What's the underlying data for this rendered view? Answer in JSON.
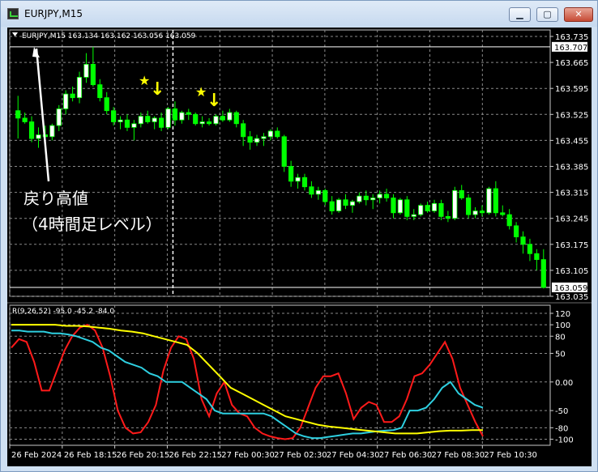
{
  "window": {
    "title": "EURJPY,M15",
    "buttons": {
      "minimize": "▁",
      "maximize": "▢",
      "close": "✕"
    }
  },
  "chart_data": [
    {
      "type": "candlestick",
      "header": "EURJPY,M15 163.134 163.162 163.056 163.059",
      "symbol": "EURJPY",
      "timeframe": "M15",
      "ohlc_header": {
        "open": 163.134,
        "high": 163.162,
        "low": 163.056,
        "close": 163.059
      },
      "y_ticks": [
        "163.735",
        "163.665",
        "163.595",
        "163.525",
        "163.455",
        "163.385",
        "163.315",
        "163.245",
        "163.175",
        "163.105",
        "163.035"
      ],
      "ylim": [
        163.035,
        163.735
      ],
      "price_labels": [
        "163.707",
        "163.059"
      ],
      "horizontal_levels": [
        163.707,
        163.059
      ],
      "x_ticks": [
        "26 Feb 2024",
        "26 Feb 18:15",
        "26 Feb 20:15",
        "26 Feb 22:15",
        "27 Feb 00:30",
        "27 Feb 02:30",
        "27 Feb 04:30",
        "27 Feb 06:30",
        "27 Feb 08:30",
        "27 Feb 10:30"
      ],
      "vertical_levels": [
        "26 Feb 22:15"
      ],
      "bull_color": "#ffffff",
      "bear_color": "#00ff00",
      "grid": true,
      "annotations": {
        "label_line1": "戻り高値",
        "label_line2": "（4時間足レベル）",
        "star": "★",
        "arrow": "↓",
        "marker_color": "#ffff00",
        "text_color": "#ffffff"
      },
      "candles": [
        {
          "o": 163.535,
          "h": 163.575,
          "l": 163.46,
          "c": 163.515
        },
        {
          "o": 163.515,
          "h": 163.53,
          "l": 163.5,
          "c": 163.505
        },
        {
          "o": 163.505,
          "h": 163.52,
          "l": 163.45,
          "c": 163.46
        },
        {
          "o": 163.46,
          "h": 163.49,
          "l": 163.435,
          "c": 163.47
        },
        {
          "o": 163.47,
          "h": 163.495,
          "l": 163.455,
          "c": 163.465
        },
        {
          "o": 163.465,
          "h": 163.5,
          "l": 163.455,
          "c": 163.495
        },
        {
          "o": 163.495,
          "h": 163.55,
          "l": 163.48,
          "c": 163.54
        },
        {
          "o": 163.54,
          "h": 163.59,
          "l": 163.525,
          "c": 163.58
        },
        {
          "o": 163.58,
          "h": 163.6,
          "l": 163.56,
          "c": 163.57
        },
        {
          "o": 163.57,
          "h": 163.64,
          "l": 163.555,
          "c": 163.625
        },
        {
          "o": 163.625,
          "h": 163.69,
          "l": 163.61,
          "c": 163.66
        },
        {
          "o": 163.66,
          "h": 163.707,
          "l": 163.6,
          "c": 163.605
        },
        {
          "o": 163.605,
          "h": 163.62,
          "l": 163.56,
          "c": 163.57
        },
        {
          "o": 163.57,
          "h": 163.585,
          "l": 163.525,
          "c": 163.535
        },
        {
          "o": 163.535,
          "h": 163.545,
          "l": 163.495,
          "c": 163.505
        },
        {
          "o": 163.505,
          "h": 163.52,
          "l": 163.485,
          "c": 163.51
        },
        {
          "o": 163.51,
          "h": 163.525,
          "l": 163.48,
          "c": 163.49
        },
        {
          "o": 163.49,
          "h": 163.51,
          "l": 163.455,
          "c": 163.5
        },
        {
          "o": 163.5,
          "h": 163.53,
          "l": 163.49,
          "c": 163.52
        },
        {
          "o": 163.52,
          "h": 163.535,
          "l": 163.5,
          "c": 163.505
        },
        {
          "o": 163.505,
          "h": 163.52,
          "l": 163.485,
          "c": 163.515
        },
        {
          "o": 163.515,
          "h": 163.53,
          "l": 163.48,
          "c": 163.49
        },
        {
          "o": 163.49,
          "h": 163.545,
          "l": 163.485,
          "c": 163.54
        },
        {
          "o": 163.54,
          "h": 163.56,
          "l": 163.495,
          "c": 163.51
        },
        {
          "o": 163.51,
          "h": 163.535,
          "l": 163.5,
          "c": 163.53
        },
        {
          "o": 163.53,
          "h": 163.54,
          "l": 163.51,
          "c": 163.525
        },
        {
          "o": 163.525,
          "h": 163.53,
          "l": 163.495,
          "c": 163.5
        },
        {
          "o": 163.5,
          "h": 163.52,
          "l": 163.49,
          "c": 163.505
        },
        {
          "o": 163.505,
          "h": 163.515,
          "l": 163.495,
          "c": 163.5
        },
        {
          "o": 163.5,
          "h": 163.525,
          "l": 163.495,
          "c": 163.52
        },
        {
          "o": 163.52,
          "h": 163.535,
          "l": 163.505,
          "c": 163.51
        },
        {
          "o": 163.51,
          "h": 163.54,
          "l": 163.505,
          "c": 163.53
        },
        {
          "o": 163.53,
          "h": 163.535,
          "l": 163.49,
          "c": 163.5
        },
        {
          "o": 163.5,
          "h": 163.51,
          "l": 163.44,
          "c": 163.465
        },
        {
          "o": 163.465,
          "h": 163.48,
          "l": 163.43,
          "c": 163.45
        },
        {
          "o": 163.45,
          "h": 163.47,
          "l": 163.44,
          "c": 163.46
        },
        {
          "o": 163.46,
          "h": 163.475,
          "l": 163.44,
          "c": 163.465
        },
        {
          "o": 163.465,
          "h": 163.485,
          "l": 163.455,
          "c": 163.48
        },
        {
          "o": 163.48,
          "h": 163.49,
          "l": 163.46,
          "c": 163.465
        },
        {
          "o": 163.465,
          "h": 163.47,
          "l": 163.37,
          "c": 163.385
        },
        {
          "o": 163.385,
          "h": 163.4,
          "l": 163.33,
          "c": 163.345
        },
        {
          "o": 163.345,
          "h": 163.365,
          "l": 163.325,
          "c": 163.355
        },
        {
          "o": 163.355,
          "h": 163.365,
          "l": 163.32,
          "c": 163.33
        },
        {
          "o": 163.33,
          "h": 163.345,
          "l": 163.3,
          "c": 163.31
        },
        {
          "o": 163.31,
          "h": 163.33,
          "l": 163.295,
          "c": 163.32
        },
        {
          "o": 163.32,
          "h": 163.325,
          "l": 163.28,
          "c": 163.29
        },
        {
          "o": 163.29,
          "h": 163.305,
          "l": 163.255,
          "c": 163.265
        },
        {
          "o": 163.265,
          "h": 163.3,
          "l": 163.26,
          "c": 163.295
        },
        {
          "o": 163.295,
          "h": 163.31,
          "l": 163.27,
          "c": 163.28
        },
        {
          "o": 163.28,
          "h": 163.295,
          "l": 163.26,
          "c": 163.29
        },
        {
          "o": 163.29,
          "h": 163.315,
          "l": 163.285,
          "c": 163.305
        },
        {
          "o": 163.305,
          "h": 163.32,
          "l": 163.28,
          "c": 163.295
        },
        {
          "o": 163.295,
          "h": 163.31,
          "l": 163.27,
          "c": 163.3
        },
        {
          "o": 163.3,
          "h": 163.32,
          "l": 163.285,
          "c": 163.31
        },
        {
          "o": 163.31,
          "h": 163.325,
          "l": 163.29,
          "c": 163.3
        },
        {
          "o": 163.3,
          "h": 163.31,
          "l": 163.245,
          "c": 163.26
        },
        {
          "o": 163.26,
          "h": 163.3,
          "l": 163.255,
          "c": 163.295
        },
        {
          "o": 163.295,
          "h": 163.305,
          "l": 163.24,
          "c": 163.25
        },
        {
          "o": 163.25,
          "h": 163.27,
          "l": 163.24,
          "c": 163.255
        },
        {
          "o": 163.255,
          "h": 163.285,
          "l": 163.25,
          "c": 163.28
        },
        {
          "o": 163.28,
          "h": 163.29,
          "l": 163.26,
          "c": 163.265
        },
        {
          "o": 163.265,
          "h": 163.295,
          "l": 163.26,
          "c": 163.285
        },
        {
          "o": 163.285,
          "h": 163.295,
          "l": 163.24,
          "c": 163.25
        },
        {
          "o": 163.25,
          "h": 163.265,
          "l": 163.235,
          "c": 163.245
        },
        {
          "o": 163.245,
          "h": 163.33,
          "l": 163.24,
          "c": 163.32
        },
        {
          "o": 163.32,
          "h": 163.335,
          "l": 163.295,
          "c": 163.3
        },
        {
          "o": 163.3,
          "h": 163.31,
          "l": 163.245,
          "c": 163.255
        },
        {
          "o": 163.255,
          "h": 163.275,
          "l": 163.245,
          "c": 163.265
        },
        {
          "o": 163.265,
          "h": 163.28,
          "l": 163.25,
          "c": 163.26
        },
        {
          "o": 163.26,
          "h": 163.33,
          "l": 163.255,
          "c": 163.325
        },
        {
          "o": 163.325,
          "h": 163.345,
          "l": 163.25,
          "c": 163.26
        },
        {
          "o": 163.26,
          "h": 163.28,
          "l": 163.25,
          "c": 163.255
        },
        {
          "o": 163.255,
          "h": 163.27,
          "l": 163.215,
          "c": 163.225
        },
        {
          "o": 163.225,
          "h": 163.235,
          "l": 163.18,
          "c": 163.195
        },
        {
          "o": 163.195,
          "h": 163.21,
          "l": 163.15,
          "c": 163.175
        },
        {
          "o": 163.175,
          "h": 163.19,
          "l": 163.13,
          "c": 163.15
        },
        {
          "o": 163.15,
          "h": 163.162,
          "l": 163.105,
          "c": 163.134
        },
        {
          "o": 163.134,
          "h": 163.162,
          "l": 163.056,
          "c": 163.059
        }
      ]
    },
    {
      "type": "line",
      "header": "R(9,26,52) -95.0 -45.2 -84.0",
      "indicator": "R(9,26,52)",
      "current_values": [
        -95.0,
        -45.2,
        -84.0
      ],
      "y_ticks": [
        "120",
        "100",
        "80",
        "50",
        "0.00",
        "-50",
        "-80",
        "-100"
      ],
      "ylim": [
        -105,
        120
      ],
      "grid": true,
      "series": [
        {
          "color": "#ff1a1a",
          "values": [
            60,
            75,
            70,
            35,
            -15,
            -15,
            20,
            55,
            80,
            95,
            100,
            90,
            60,
            10,
            -50,
            -80,
            -90,
            -88,
            -70,
            -40,
            20,
            60,
            80,
            75,
            40,
            -30,
            -60,
            -20,
            0,
            -40,
            -55,
            -60,
            -80,
            -90,
            -95,
            -98,
            -100,
            -98,
            -80,
            -45,
            -10,
            10,
            10,
            15,
            -20,
            -65,
            -45,
            -35,
            -40,
            -70,
            -70,
            -60,
            -30,
            10,
            15,
            30,
            50,
            70,
            40,
            -10,
            -40,
            -70,
            -95
          ]
        },
        {
          "color": "#2ecfe0",
          "values": [
            90,
            90,
            88,
            88,
            88,
            85,
            85,
            83,
            80,
            75,
            70,
            60,
            55,
            45,
            35,
            30,
            25,
            15,
            10,
            0,
            0,
            0,
            -10,
            -20,
            -30,
            -50,
            -55,
            -55,
            -55,
            -55,
            -55,
            -55,
            -60,
            -70,
            -80,
            -90,
            -95,
            -98,
            -98,
            -96,
            -94,
            -92,
            -90,
            -90,
            -88,
            -86,
            -85,
            -84,
            -80,
            -50,
            -50,
            -45,
            -30,
            -10,
            0,
            -20,
            -30,
            -40,
            -45
          ]
        },
        {
          "color": "#ffff00",
          "values": [
            100,
            100,
            100,
            100,
            100,
            98,
            98,
            97,
            95,
            93,
            90,
            88,
            85,
            80,
            75,
            70,
            65,
            50,
            30,
            10,
            -10,
            -20,
            -30,
            -40,
            -50,
            -60,
            -65,
            -70,
            -75,
            -78,
            -80,
            -82,
            -84,
            -86,
            -88,
            -90,
            -90,
            -90,
            -88,
            -86,
            -85,
            -85,
            -84,
            -84
          ]
        }
      ]
    }
  ]
}
